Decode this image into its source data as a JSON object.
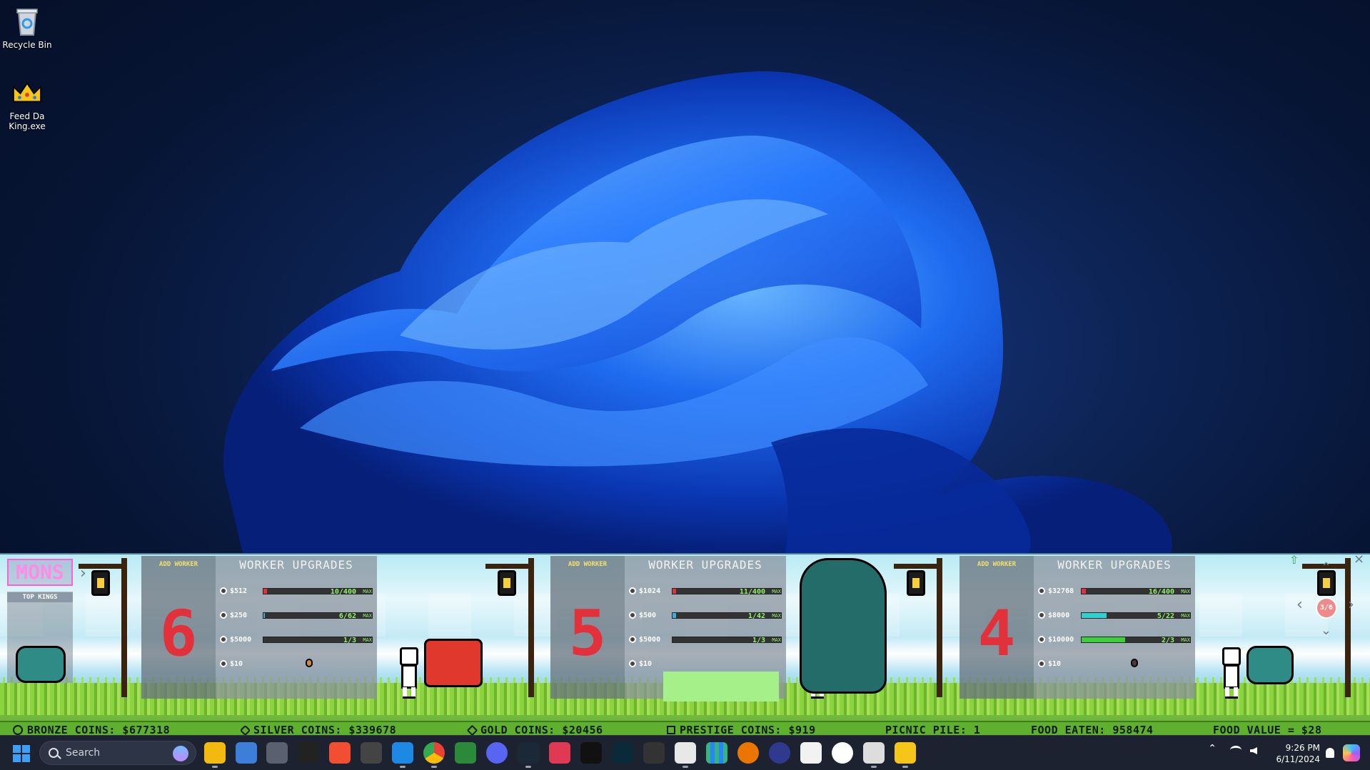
{
  "desktop": {
    "icons": [
      {
        "label": "Recycle Bin",
        "icon": "recycle-bin-icon"
      },
      {
        "label": "Feed Da King.exe",
        "icon": "crown-icon"
      }
    ]
  },
  "game": {
    "logo": "MONS",
    "top_kings_title": "TOP KINGS",
    "panels": [
      {
        "add_label": "ADD WORKER",
        "number": "6",
        "title": "WORKER UPGRADES",
        "rows": [
          {
            "price": "$512",
            "stat": "10/400",
            "max": "MAX",
            "fill": 0.02
          },
          {
            "price": "$250",
            "stat": "6/62",
            "max": "MAX",
            "fill": 0.0
          },
          {
            "price": "$5000",
            "stat": "1/3",
            "max": "MAX",
            "fill": 0.0
          },
          {
            "price": "$10",
            "stat": "",
            "max": "",
            "fill": 0.0
          }
        ]
      },
      {
        "add_label": "ADD WORKER",
        "number": "5",
        "title": "WORKER UPGRADES",
        "rows": [
          {
            "price": "$1024",
            "stat": "11/400",
            "max": "MAX",
            "fill": 0.03
          },
          {
            "price": "$500",
            "stat": "1/42",
            "max": "MAX",
            "fill": 0.02
          },
          {
            "price": "$5000",
            "stat": "1/3",
            "max": "MAX",
            "fill": 0.0
          },
          {
            "price": "$10",
            "stat": "",
            "max": "",
            "fill": 0.0
          }
        ]
      },
      {
        "add_label": "ADD WORKER",
        "number": "4",
        "title": "WORKER UPGRADES",
        "rows": [
          {
            "price": "$32768",
            "stat": "16/400",
            "max": "MAX",
            "fill": 0.04
          },
          {
            "price": "$8000",
            "stat": "5/22",
            "max": "MAX",
            "fill": 0.23
          },
          {
            "price": "$10000",
            "stat": "2/3",
            "max": "MAX",
            "fill": 0.66
          },
          {
            "price": "$10",
            "stat": "",
            "max": "",
            "fill": 0.0
          }
        ]
      }
    ],
    "page_indicator": "3/6",
    "status": {
      "bronze": "BRONZE COINS: $677318",
      "silver": "SILVER COINS: $339678",
      "gold": "GOLD COINS: $20456",
      "prestige": "PRESTIGE COINS: $919",
      "picnic": "PICNIC PILE: 1",
      "eaten": "FOOD EATEN: 958474",
      "value": "FOOD VALUE = $28"
    }
  },
  "taskbar": {
    "search_placeholder": "Search",
    "apps": [
      "file-explorer",
      "photos",
      "calculator",
      "terminal",
      "app-diamond",
      "app-cube",
      "vscode",
      "chrome",
      "app-green",
      "discord",
      "steam",
      "app-red",
      "app-orange",
      "app-lol",
      "app-game",
      "app-paint",
      "app-grid",
      "blender",
      "app-dark",
      "app-epic",
      "app-github",
      "unity",
      "feed-da-king"
    ],
    "time": "9:26 PM",
    "date": "6/11/2024"
  },
  "colors": {
    "accent": "#3ea0f5",
    "status_bar": "#5fb02f",
    "number_red": "#e3313b"
  }
}
